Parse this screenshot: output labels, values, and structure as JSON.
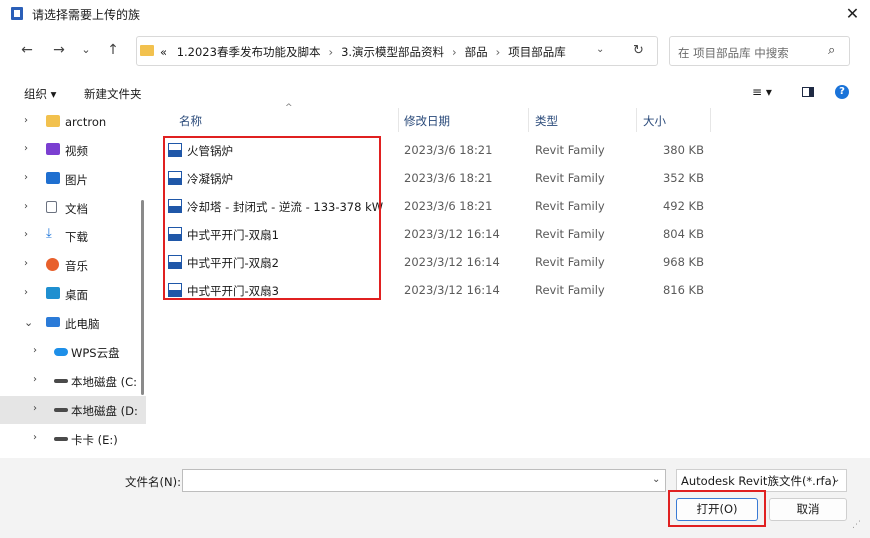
{
  "window": {
    "title": "请选择需要上传的族",
    "close_glyph": "✕"
  },
  "nav_buttons": {
    "back": "←",
    "forward": "→",
    "recent": "⌄",
    "up": "↑"
  },
  "address": {
    "prefix": "«",
    "crumbs": [
      "1.2023春季发布功能及脚本",
      "3.演示模型部品资料",
      "部品",
      "项目部品库"
    ],
    "sep": "›"
  },
  "search": {
    "placeholder": "在 项目部品库 中搜索"
  },
  "toolbar": {
    "organize": "组织 ▾",
    "new_folder": "新建文件夹",
    "view": "≡ ▾",
    "help": "?"
  },
  "sidebar": {
    "items": [
      {
        "label": "arctron",
        "icon": "folder-icon",
        "color": "#f2c14e"
      },
      {
        "label": "视频",
        "icon": "video-icon",
        "color": "#7b3fd1"
      },
      {
        "label": "图片",
        "icon": "pictures-icon",
        "color": "#1f6fd0"
      },
      {
        "label": "文档",
        "icon": "documents-icon",
        "color": "#6b7280"
      },
      {
        "label": "下载",
        "icon": "downloads-icon",
        "color": "#1a73d9"
      },
      {
        "label": "音乐",
        "icon": "music-icon",
        "color": "#e8602c"
      },
      {
        "label": "桌面",
        "icon": "desktop-icon",
        "color": "#1f8fd0"
      },
      {
        "label": "此电脑",
        "icon": "this-pc-icon",
        "color": "#2b7bd8"
      },
      {
        "label": "WPS云盘",
        "icon": "wps-cloud-icon",
        "color": "#1e8fe8"
      },
      {
        "label": "本地磁盘 (C:",
        "icon": "drive-c-icon",
        "color": "#4a4a4a"
      },
      {
        "label": "本地磁盘 (D:",
        "icon": "drive-d-icon",
        "color": "#4a4a4a"
      },
      {
        "label": "卡卡 (E:)",
        "icon": "drive-e-icon",
        "color": "#4a4a4a"
      }
    ]
  },
  "columns": {
    "name": "名称",
    "date": "修改日期",
    "type": "类型",
    "size": "大小"
  },
  "files": [
    {
      "name": "火管锅炉",
      "date": "2023/3/6 18:21",
      "type": "Revit Family",
      "size": "380 KB"
    },
    {
      "name": "冷凝锅炉",
      "date": "2023/3/6 18:21",
      "type": "Revit Family",
      "size": "352 KB"
    },
    {
      "name": "冷却塔 - 封闭式 - 逆流 - 133-378 kW",
      "date": "2023/3/6 18:21",
      "type": "Revit Family",
      "size": "492 KB"
    },
    {
      "name": "中式平开门-双扇1",
      "date": "2023/3/12 16:14",
      "type": "Revit Family",
      "size": "804 KB"
    },
    {
      "name": "中式平开门-双扇2",
      "date": "2023/3/12 16:14",
      "type": "Revit Family",
      "size": "968 KB"
    },
    {
      "name": "中式平开门-双扇3",
      "date": "2023/3/12 16:14",
      "type": "Revit Family",
      "size": "816 KB"
    }
  ],
  "footer": {
    "filename_label": "文件名(N):",
    "filename_value": "",
    "filter": "Autodesk Revit族文件(*.rfa)",
    "open": "打开(O)",
    "cancel": "取消"
  },
  "colors": {
    "highlight_box": "#e02020",
    "accent": "#1a73d9"
  }
}
